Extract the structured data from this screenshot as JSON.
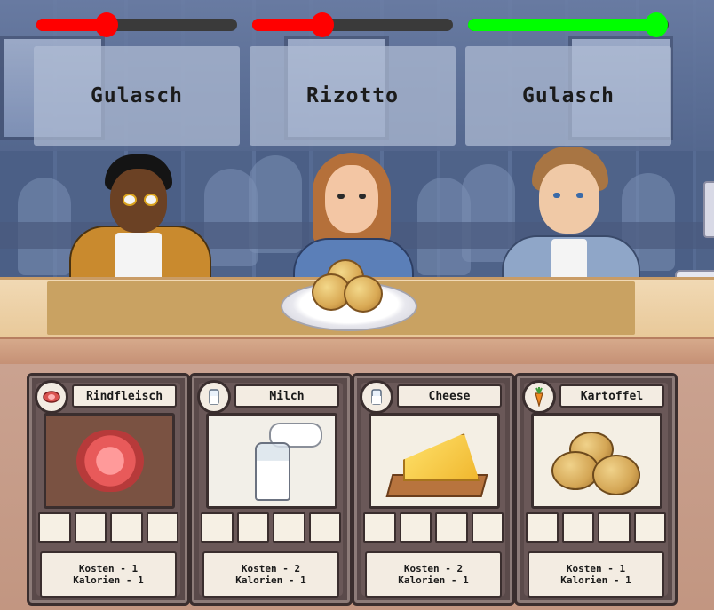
{
  "progress_bars": [
    {
      "level": 0.35,
      "color": "#ff0000"
    },
    {
      "level": 0.35,
      "color": "#ff0000"
    },
    {
      "level": 0.94,
      "color": "#00ff00"
    }
  ],
  "orders": [
    "Gulasch",
    "Rizotto",
    "Gulasch"
  ],
  "plate": {
    "contents": "potatoes",
    "count": 3
  },
  "cards": [
    {
      "name": "Rindfleisch",
      "icon": "meat-icon",
      "cost_text": "Kosten - 1",
      "calories_text": "Kalorien - 1"
    },
    {
      "name": "Milch",
      "icon": "milk-icon",
      "cost_text": "Kosten - 2",
      "calories_text": "Kalorien - 1"
    },
    {
      "name": "Cheese",
      "icon": "milk-icon",
      "cost_text": "Kosten - 2",
      "calories_text": "Kalorien - 1"
    },
    {
      "name": "Kartoffel",
      "icon": "carrot-icon",
      "cost_text": "Kosten - 1",
      "calories_text": "Kalorien - 1"
    }
  ]
}
